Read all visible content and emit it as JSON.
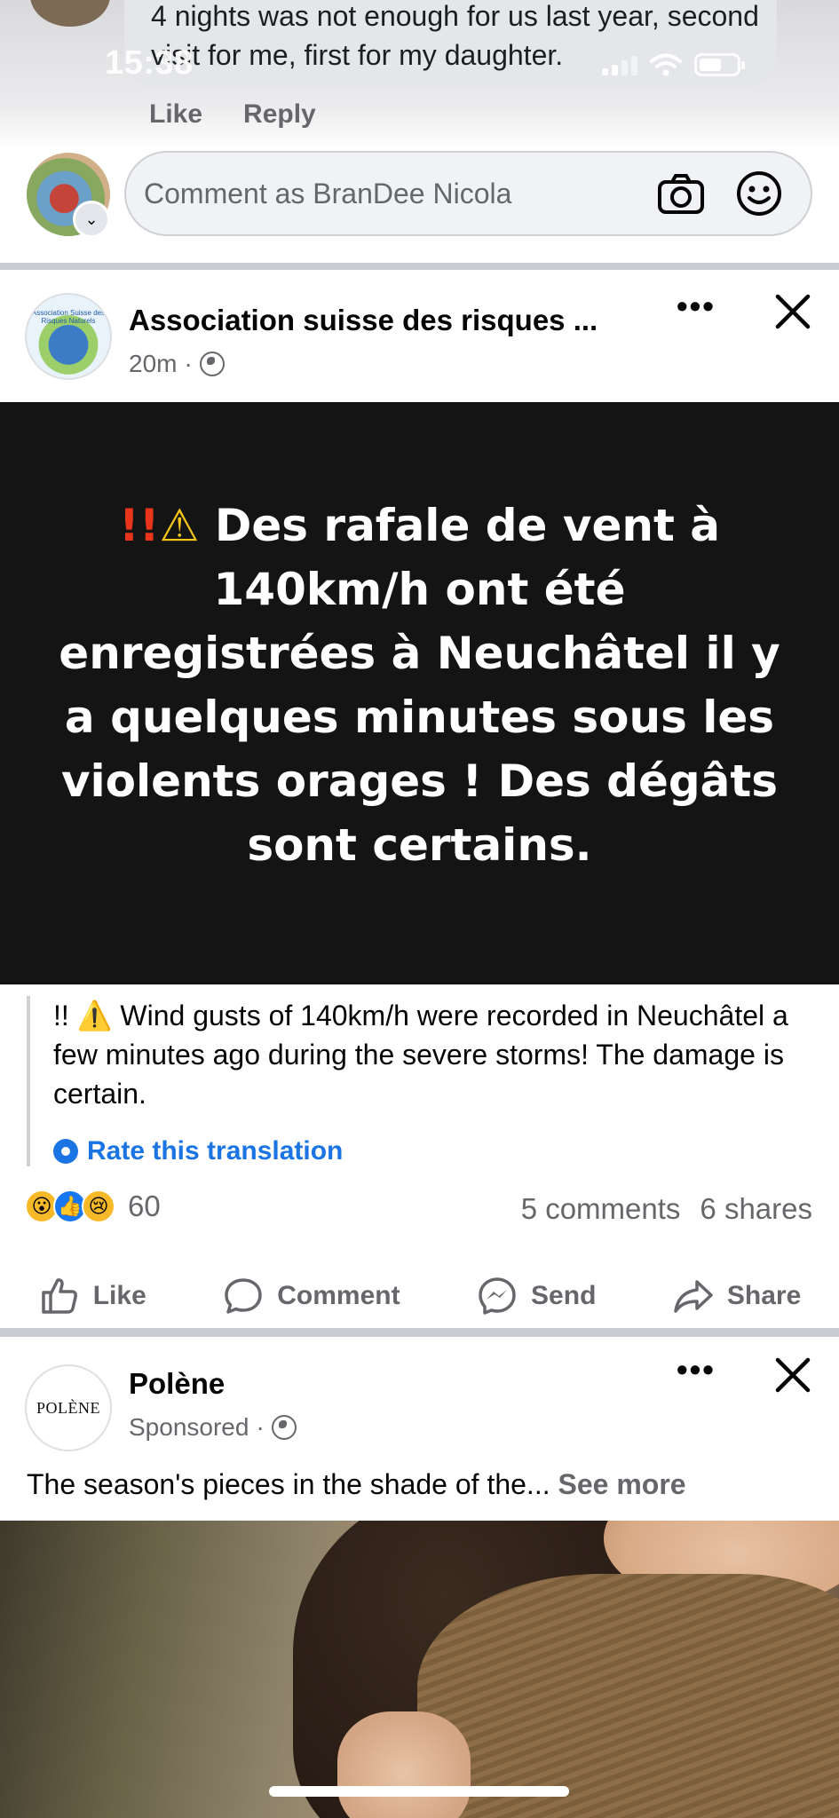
{
  "status_bar": {
    "time": "15:38"
  },
  "previous_comment": {
    "text": "4 nights was not enough for us last year, second visit for me, first for my daughter.",
    "actions": {
      "like": "Like",
      "reply": "Reply"
    }
  },
  "composer": {
    "placeholder": "Comment as BranDee Nicola"
  },
  "post": {
    "page_name": "Association suisse des risques ...",
    "time": "20m",
    "avatar_text": "Association Suisse des Risques Naturels",
    "card": {
      "prefix_bang": "!!",
      "prefix_warn": "⚠",
      "text": "Des rafale de vent à 140km/h ont été enregistrées à Neuchâtel il y a quelques minutes sous les violents orages ! Des dégâts sont certains."
    },
    "translation": "!! ⚠️ Wind gusts of 140km/h were recorded in Neuchâtel a few minutes ago during the severe storms! The damage is certain.",
    "rate_translation": "Rate this translation",
    "reaction_count": "60",
    "comments": "5 comments",
    "shares": "6 shares",
    "actions": {
      "like": "Like",
      "comment": "Comment",
      "send": "Send",
      "share": "Share"
    }
  },
  "sponsored_post": {
    "brand_name": "Polène",
    "brand_logo": "POLÈNE",
    "label": "Sponsored",
    "text": "The season's pieces in the shade of the...",
    "see_more": "See more"
  },
  "colors": {
    "link_blue": "#1b74e4",
    "secondary_text": "#65676b",
    "card_bg": "#141414"
  },
  "icons": [
    "camera-icon",
    "smiley-icon",
    "more-icon",
    "close-icon",
    "globe-icon",
    "gear-icon",
    "like-icon",
    "comment-icon",
    "messenger-icon",
    "share-icon"
  ]
}
